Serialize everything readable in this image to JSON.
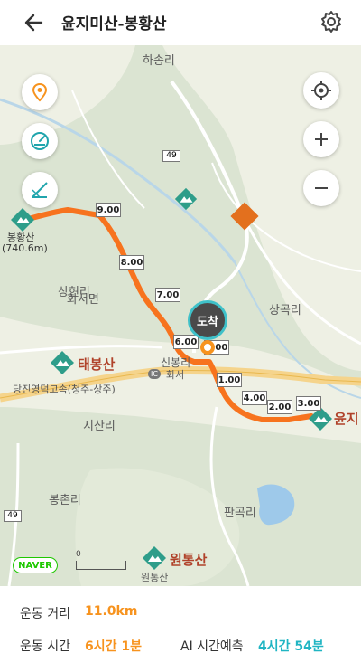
{
  "header": {
    "title": "윤지미산-봉황산"
  },
  "map": {
    "places": {
      "hasongri": "하송리",
      "sanghyeonri": "상현리",
      "hwaseomyeon": "화서면",
      "sanggokri": "상곡리",
      "sinbongri": "신봉리",
      "hwaseo": "화서",
      "jisanri": "지산리",
      "bongchonri": "봉촌리",
      "pangokri": "판곡리",
      "road_name": "당진영덕고속(청주-상주)"
    },
    "mountains": {
      "bonghwangsan": "봉황산",
      "bonghwangsan_elev": "(740.6m)",
      "taebongsan": "태봉산",
      "yunji": "윤지",
      "wontongsan": "원통산",
      "wontongsan_sub": "원통산"
    },
    "road_numbers": {
      "r49a": "49",
      "r49b": "49"
    },
    "ic_label": "IC",
    "arrival_label": "도착",
    "markers": [
      "9.00",
      "8.00",
      "7.00",
      "6.00",
      "1.00",
      "2.00",
      "3.00",
      "4.00",
      "5.00"
    ],
    "naver_label": "NAVER",
    "scale_label": "0",
    "colors": {
      "route": "#f7731e",
      "marker": "#1a1aa0",
      "accent": "#3fc1c9"
    }
  },
  "stats": {
    "distance_label": "운동 거리",
    "distance_value": "11.0km",
    "time_label": "운동 시간",
    "time_value": "6시간 1분",
    "ai_label": "AI 시간예측",
    "ai_value": "4시간 54분"
  }
}
